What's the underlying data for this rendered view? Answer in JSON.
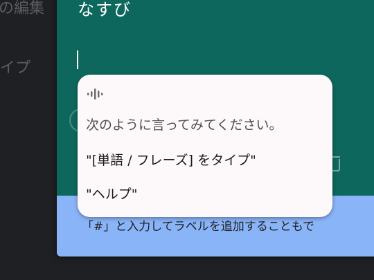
{
  "background": {
    "edit_label": "の編集",
    "type_label": "イプ"
  },
  "card": {
    "title": "なすび",
    "footer_hint": "「#」と入力してラベルを追加することもで"
  },
  "voice_popup": {
    "icon": "voice-wave-icon",
    "prompt": "次のように言ってみてください。",
    "suggestions": [
      "\"[単語 / フレーズ] をタイプ\"",
      "\"ヘルプ\""
    ]
  },
  "colors": {
    "card_bg": "#0e675d",
    "footer_bg": "#8ab4f8",
    "popup_bg": "#fdf8fa",
    "page_bg": "#1f2023"
  }
}
